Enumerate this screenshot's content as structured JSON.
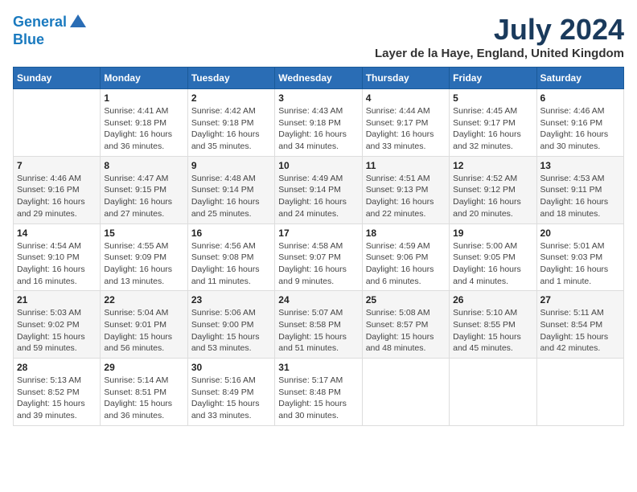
{
  "logo": {
    "line1": "General",
    "line2": "Blue"
  },
  "title": "July 2024",
  "location": "Layer de la Haye, England, United Kingdom",
  "days_of_week": [
    "Sunday",
    "Monday",
    "Tuesday",
    "Wednesday",
    "Thursday",
    "Friday",
    "Saturday"
  ],
  "weeks": [
    [
      {
        "day": "",
        "info": ""
      },
      {
        "day": "1",
        "info": "Sunrise: 4:41 AM\nSunset: 9:18 PM\nDaylight: 16 hours\nand 36 minutes."
      },
      {
        "day": "2",
        "info": "Sunrise: 4:42 AM\nSunset: 9:18 PM\nDaylight: 16 hours\nand 35 minutes."
      },
      {
        "day": "3",
        "info": "Sunrise: 4:43 AM\nSunset: 9:18 PM\nDaylight: 16 hours\nand 34 minutes."
      },
      {
        "day": "4",
        "info": "Sunrise: 4:44 AM\nSunset: 9:17 PM\nDaylight: 16 hours\nand 33 minutes."
      },
      {
        "day": "5",
        "info": "Sunrise: 4:45 AM\nSunset: 9:17 PM\nDaylight: 16 hours\nand 32 minutes."
      },
      {
        "day": "6",
        "info": "Sunrise: 4:46 AM\nSunset: 9:16 PM\nDaylight: 16 hours\nand 30 minutes."
      }
    ],
    [
      {
        "day": "7",
        "info": "Sunrise: 4:46 AM\nSunset: 9:16 PM\nDaylight: 16 hours\nand 29 minutes."
      },
      {
        "day": "8",
        "info": "Sunrise: 4:47 AM\nSunset: 9:15 PM\nDaylight: 16 hours\nand 27 minutes."
      },
      {
        "day": "9",
        "info": "Sunrise: 4:48 AM\nSunset: 9:14 PM\nDaylight: 16 hours\nand 25 minutes."
      },
      {
        "day": "10",
        "info": "Sunrise: 4:49 AM\nSunset: 9:14 PM\nDaylight: 16 hours\nand 24 minutes."
      },
      {
        "day": "11",
        "info": "Sunrise: 4:51 AM\nSunset: 9:13 PM\nDaylight: 16 hours\nand 22 minutes."
      },
      {
        "day": "12",
        "info": "Sunrise: 4:52 AM\nSunset: 9:12 PM\nDaylight: 16 hours\nand 20 minutes."
      },
      {
        "day": "13",
        "info": "Sunrise: 4:53 AM\nSunset: 9:11 PM\nDaylight: 16 hours\nand 18 minutes."
      }
    ],
    [
      {
        "day": "14",
        "info": "Sunrise: 4:54 AM\nSunset: 9:10 PM\nDaylight: 16 hours\nand 16 minutes."
      },
      {
        "day": "15",
        "info": "Sunrise: 4:55 AM\nSunset: 9:09 PM\nDaylight: 16 hours\nand 13 minutes."
      },
      {
        "day": "16",
        "info": "Sunrise: 4:56 AM\nSunset: 9:08 PM\nDaylight: 16 hours\nand 11 minutes."
      },
      {
        "day": "17",
        "info": "Sunrise: 4:58 AM\nSunset: 9:07 PM\nDaylight: 16 hours\nand 9 minutes."
      },
      {
        "day": "18",
        "info": "Sunrise: 4:59 AM\nSunset: 9:06 PM\nDaylight: 16 hours\nand 6 minutes."
      },
      {
        "day": "19",
        "info": "Sunrise: 5:00 AM\nSunset: 9:05 PM\nDaylight: 16 hours\nand 4 minutes."
      },
      {
        "day": "20",
        "info": "Sunrise: 5:01 AM\nSunset: 9:03 PM\nDaylight: 16 hours\nand 1 minute."
      }
    ],
    [
      {
        "day": "21",
        "info": "Sunrise: 5:03 AM\nSunset: 9:02 PM\nDaylight: 15 hours\nand 59 minutes."
      },
      {
        "day": "22",
        "info": "Sunrise: 5:04 AM\nSunset: 9:01 PM\nDaylight: 15 hours\nand 56 minutes."
      },
      {
        "day": "23",
        "info": "Sunrise: 5:06 AM\nSunset: 9:00 PM\nDaylight: 15 hours\nand 53 minutes."
      },
      {
        "day": "24",
        "info": "Sunrise: 5:07 AM\nSunset: 8:58 PM\nDaylight: 15 hours\nand 51 minutes."
      },
      {
        "day": "25",
        "info": "Sunrise: 5:08 AM\nSunset: 8:57 PM\nDaylight: 15 hours\nand 48 minutes."
      },
      {
        "day": "26",
        "info": "Sunrise: 5:10 AM\nSunset: 8:55 PM\nDaylight: 15 hours\nand 45 minutes."
      },
      {
        "day": "27",
        "info": "Sunrise: 5:11 AM\nSunset: 8:54 PM\nDaylight: 15 hours\nand 42 minutes."
      }
    ],
    [
      {
        "day": "28",
        "info": "Sunrise: 5:13 AM\nSunset: 8:52 PM\nDaylight: 15 hours\nand 39 minutes."
      },
      {
        "day": "29",
        "info": "Sunrise: 5:14 AM\nSunset: 8:51 PM\nDaylight: 15 hours\nand 36 minutes."
      },
      {
        "day": "30",
        "info": "Sunrise: 5:16 AM\nSunset: 8:49 PM\nDaylight: 15 hours\nand 33 minutes."
      },
      {
        "day": "31",
        "info": "Sunrise: 5:17 AM\nSunset: 8:48 PM\nDaylight: 15 hours\nand 30 minutes."
      },
      {
        "day": "",
        "info": ""
      },
      {
        "day": "",
        "info": ""
      },
      {
        "day": "",
        "info": ""
      }
    ]
  ]
}
